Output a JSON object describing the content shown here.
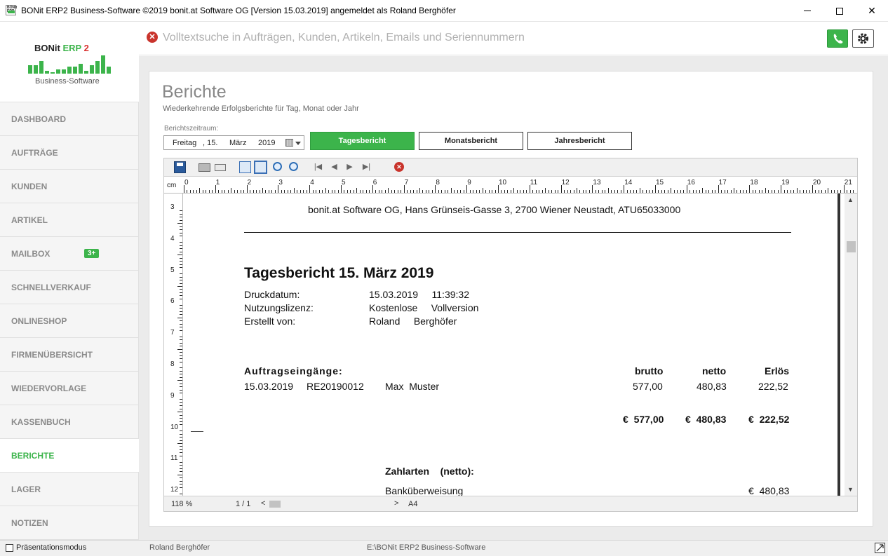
{
  "window": {
    "title": "BONit ERP2 Business-Software ©2019 bonit.at Software OG [Version 15.03.2019] angemeldet als Roland Berghöfer",
    "icon_text": "BONit ERP"
  },
  "logo": {
    "name": "BONit",
    "erp": "ERP",
    "version": "2",
    "subtitle": "Business-Software"
  },
  "sidebar": {
    "items": [
      {
        "label": "DASHBOARD"
      },
      {
        "label": "AUFTRÄGE"
      },
      {
        "label": "KUNDEN"
      },
      {
        "label": "ARTIKEL"
      },
      {
        "label": "MAILBOX",
        "badge": "3+"
      },
      {
        "label": "SCHNELLVERKAUF"
      },
      {
        "label": "ONLINESHOP"
      },
      {
        "label": "FIRMENÜBERSICHT"
      },
      {
        "label": "WIEDERVORLAGE"
      },
      {
        "label": "KASSENBUCH"
      },
      {
        "label": "BERICHTE",
        "active": true
      },
      {
        "label": "LAGER"
      },
      {
        "label": "NOTIZEN"
      }
    ]
  },
  "search": {
    "placeholder": "Volltextsuche in Aufträgen, Kunden, Artikeln, Emails und Seriennummern",
    "value": ""
  },
  "page": {
    "title": "Berichte",
    "subtitle": "Wiederkehrende Erfolgsberichte für Tag, Monat oder Jahr",
    "period_label": "Berichtszeitraum:",
    "date": {
      "weekday": "Freitag",
      "day": ", 15.",
      "month": "März",
      "year": "2019"
    },
    "buttons": {
      "daily": "Tagesbericht",
      "monthly": "Monatsbericht",
      "yearly": "Jahresbericht"
    }
  },
  "viewer": {
    "ruler_unit": "cm",
    "ruler_top": [
      "0",
      "1",
      "2",
      "3",
      "4",
      "5",
      "6",
      "7",
      "8",
      "9",
      "10",
      "11",
      "12",
      "13",
      "14",
      "15",
      "16",
      "17",
      "18",
      "19",
      "20",
      "21"
    ],
    "ruler_left": [
      "3",
      "4",
      "5",
      "6",
      "7",
      "8",
      "9",
      "10",
      "11",
      "12"
    ],
    "zoom": "118 %",
    "page_count": "1 / 1",
    "paper": "A4"
  },
  "report": {
    "header": "bonit.at  Software  OG,  Hans  Grünseis-Gasse  3,  2700  Wiener  Neustadt,  ATU65033000",
    "title": "Tagesbericht 15. März 2019",
    "meta": [
      {
        "label": "Druckdatum:",
        "value": "15.03.2019     11:39:32"
      },
      {
        "label": "Nutzungslizenz:",
        "value": "Kostenlose     Vollversion"
      },
      {
        "label": "Erstellt von:",
        "value": "Roland     Berghöfer"
      }
    ],
    "section": "Auftragseingänge:",
    "columns": {
      "brutto": "brutto",
      "netto": "netto",
      "erloes": "Erlös"
    },
    "row": {
      "date": "15.03.2019",
      "number": "RE20190012",
      "customer": "Max  Muster",
      "brutto": "577,00",
      "netto": "480,83",
      "erloes": "222,52"
    },
    "totals": {
      "brutto": "€  577,00",
      "netto": "€  480,83",
      "erloes": "€  222,52"
    },
    "payments_title": "Zahlarten    (netto):",
    "payment": {
      "label": "Banküberweisung",
      "value": "€  480,83"
    }
  },
  "statusbar": {
    "presentation": "Präsentationsmodus",
    "user": "Roland Berghöfer",
    "path": "E:\\BONit ERP2 Business-Software"
  }
}
